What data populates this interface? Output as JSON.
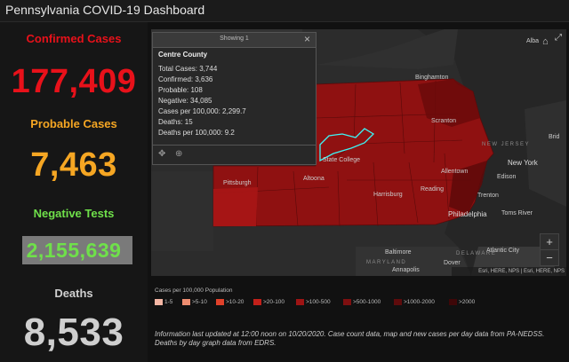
{
  "header": {
    "title": "Pennsylvania COVID-19 Dashboard"
  },
  "stats": [
    {
      "label": "Confirmed Cases",
      "value": "177,409",
      "color": "#e8111a"
    },
    {
      "label": "Probable Cases",
      "value": "7,463",
      "color": "#f5a623"
    },
    {
      "label": "Negative Tests",
      "value": "2,155,639",
      "color": "#6fe04a"
    },
    {
      "label": "Deaths",
      "value": "8,533",
      "color": "#cfcfcf"
    }
  ],
  "popup": {
    "showing": "Showing 1",
    "county": "Centre County",
    "lines": [
      "Total Cases: 3,744",
      "Confirmed: 3,636",
      "Probable: 108",
      "Negative: 34,085",
      "Cases per 100,000: 2,299.7",
      "Deaths: 15",
      "Deaths per 100,000: 9.2"
    ]
  },
  "map": {
    "labels": {
      "binghamton": "Binghamton",
      "scranton": "Scranton",
      "state_college": "State College",
      "pittsburgh": "Pittsburgh",
      "altoona": "Altoona",
      "harrisburg": "Harrisburg",
      "reading": "Reading",
      "allentown": "Allentown",
      "new_york": "New York",
      "edison": "Edison",
      "trenton": "Trenton",
      "philadelphia": "Philadelphia",
      "toms_river": "Toms River",
      "atlantic_city": "Atlantic City",
      "baltimore": "Baltimore",
      "dover": "Dover",
      "annapolis": "Annapolis",
      "alba": "Alba",
      "brid": "Brid",
      "new_jersey": "NEW JERSEY",
      "maryland": "MARYLAND",
      "delaware": "DELAWARE"
    },
    "zoom_in": "+",
    "zoom_out": "−",
    "attribution": "Esri, HERE, NPS | Esri, HERE, NPS"
  },
  "legend": {
    "title": "Cases per 100,000 Population",
    "items": [
      {
        "label": "1-5",
        "color": "#f4b6a4"
      },
      {
        "label": ">5-10",
        "color": "#ee8d70"
      },
      {
        "label": ">10-20",
        "color": "#e0412a"
      },
      {
        "label": ">20-100",
        "color": "#c2201a"
      },
      {
        "label": ">100-500",
        "color": "#9e1414"
      },
      {
        "label": ">500-1000",
        "color": "#7e0f10"
      },
      {
        "label": ">1000-2000",
        "color": "#5e0b0c"
      },
      {
        "label": ">2000",
        "color": "#3e0708"
      }
    ]
  },
  "info": "Information last updated at 12:00 noon on 10/20/2020. Case count data, map and new cases per day data from PA-NEDSS.  Deaths by day graph data from EDRS."
}
